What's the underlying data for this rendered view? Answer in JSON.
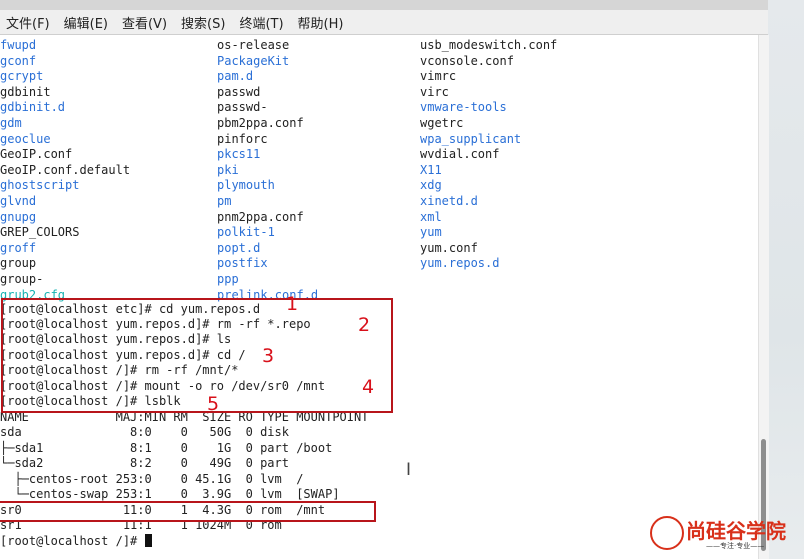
{
  "menubar": {
    "items": [
      "文件(F)",
      "编辑(E)",
      "查看(V)",
      "搜索(S)",
      "终端(T)",
      "帮助(H)"
    ]
  },
  "listing": [
    [
      {
        "t": "fwupd",
        "c": "blue"
      },
      {
        "t": "os-release",
        "c": "plain"
      },
      {
        "t": "usb_modeswitch.conf",
        "c": "plain"
      }
    ],
    [
      {
        "t": "gconf",
        "c": "blue"
      },
      {
        "t": "PackageKit",
        "c": "blue"
      },
      {
        "t": "vconsole.conf",
        "c": "plain"
      }
    ],
    [
      {
        "t": "gcrypt",
        "c": "blue"
      },
      {
        "t": "pam.d",
        "c": "blue"
      },
      {
        "t": "vimrc",
        "c": "plain"
      }
    ],
    [
      {
        "t": "gdbinit",
        "c": "plain"
      },
      {
        "t": "passwd",
        "c": "plain"
      },
      {
        "t": "virc",
        "c": "plain"
      }
    ],
    [
      {
        "t": "gdbinit.d",
        "c": "blue"
      },
      {
        "t": "passwd-",
        "c": "plain"
      },
      {
        "t": "vmware-tools",
        "c": "blue"
      }
    ],
    [
      {
        "t": "gdm",
        "c": "blue"
      },
      {
        "t": "pbm2ppa.conf",
        "c": "plain"
      },
      {
        "t": "wgetrc",
        "c": "plain"
      }
    ],
    [
      {
        "t": "geoclue",
        "c": "blue"
      },
      {
        "t": "pinforc",
        "c": "plain"
      },
      {
        "t": "wpa_supplicant",
        "c": "blue"
      }
    ],
    [
      {
        "t": "GeoIP.conf",
        "c": "plain"
      },
      {
        "t": "pkcs11",
        "c": "blue"
      },
      {
        "t": "wvdial.conf",
        "c": "plain"
      }
    ],
    [
      {
        "t": "GeoIP.conf.default",
        "c": "plain"
      },
      {
        "t": "pki",
        "c": "blue"
      },
      {
        "t": "X11",
        "c": "blue"
      }
    ],
    [
      {
        "t": "ghostscript",
        "c": "blue"
      },
      {
        "t": "plymouth",
        "c": "blue"
      },
      {
        "t": "xdg",
        "c": "blue"
      }
    ],
    [
      {
        "t": "glvnd",
        "c": "blue"
      },
      {
        "t": "pm",
        "c": "blue"
      },
      {
        "t": "xinetd.d",
        "c": "blue"
      }
    ],
    [
      {
        "t": "gnupg",
        "c": "blue"
      },
      {
        "t": "pnm2ppa.conf",
        "c": "plain"
      },
      {
        "t": "xml",
        "c": "blue"
      }
    ],
    [
      {
        "t": "GREP_COLORS",
        "c": "plain"
      },
      {
        "t": "polkit-1",
        "c": "blue"
      },
      {
        "t": "yum",
        "c": "blue"
      }
    ],
    [
      {
        "t": "groff",
        "c": "blue"
      },
      {
        "t": "popt.d",
        "c": "blue"
      },
      {
        "t": "yum.conf",
        "c": "plain"
      }
    ],
    [
      {
        "t": "group",
        "c": "plain"
      },
      {
        "t": "postfix",
        "c": "blue"
      },
      {
        "t": "yum.repos.d",
        "c": "blue"
      }
    ],
    [
      {
        "t": "group-",
        "c": "plain"
      },
      {
        "t": "ppp",
        "c": "blue"
      },
      {
        "t": "",
        "c": "plain"
      }
    ],
    [
      {
        "t": "grub2.cfg",
        "c": "cyan"
      },
      {
        "t": "prelink.conf.d",
        "c": "blue"
      },
      {
        "t": "",
        "c": "plain"
      }
    ]
  ],
  "commands": [
    "[root@localhost etc]# cd yum.repos.d",
    "[root@localhost yum.repos.d]# rm -rf *.repo",
    "[root@localhost yum.repos.d]# ls",
    "[root@localhost yum.repos.d]# cd /",
    "[root@localhost /]# rm -rf /mnt/*",
    "[root@localhost /]# mount -o ro /dev/sr0 /mnt",
    "[root@localhost /]# lsblk"
  ],
  "lsblk": {
    "header": "NAME            MAJ:MIN RM  SIZE RO TYPE MOUNTPOINT",
    "rows": [
      "sda               8:0    0   50G  0 disk",
      "├─sda1            8:1    0    1G  0 part /boot",
      "└─sda2            8:2    0   49G  0 part",
      "  ├─centos-root 253:0    0 45.1G  0 lvm  /",
      "  └─centos-swap 253:1    0  3.9G  0 lvm  [SWAP]",
      "sr0              11:0    1  4.3G  0 rom  /mnt",
      "sr1              11:1    1 1024M  0 rom"
    ]
  },
  "final_prompt": "[root@localhost /]# ",
  "annotations": [
    "1",
    "2",
    "3",
    "4",
    "5"
  ],
  "watermark": {
    "name": "尚硅谷学院",
    "sub": "——专注·专业——"
  },
  "colors": {
    "annotation_red": "#d8101a",
    "dir_blue": "#2a6fd6",
    "link_cyan": "#17b3b3"
  }
}
